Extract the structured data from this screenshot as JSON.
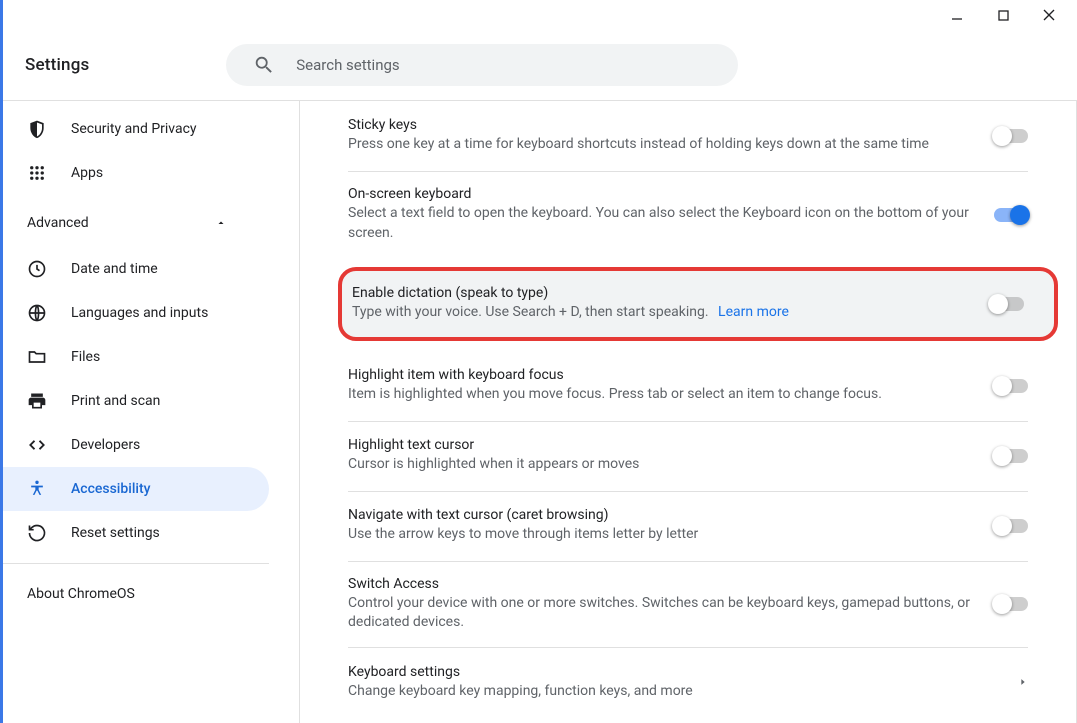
{
  "app": {
    "title": "Settings"
  },
  "search": {
    "placeholder": "Search settings"
  },
  "sidebar": {
    "items": {
      "security": "Security and Privacy",
      "apps": "Apps",
      "advanced": "Advanced",
      "date": "Date and time",
      "lang": "Languages and inputs",
      "files": "Files",
      "print": "Print and scan",
      "dev": "Developers",
      "access": "Accessibility",
      "reset": "Reset settings"
    },
    "about": "About ChromeOS"
  },
  "settings": {
    "sticky": {
      "title": "Sticky keys",
      "desc": "Press one key at a time for keyboard shortcuts instead of holding keys down at the same time",
      "on": false
    },
    "osk": {
      "title": "On-screen keyboard",
      "desc": "Select a text field to open the keyboard. You can also select the Keyboard icon on the bottom of your screen.",
      "on": true
    },
    "dictation": {
      "title": "Enable dictation (speak to type)",
      "desc": "Type with your voice. Use Search + D, then start speaking.",
      "learn": "Learn more",
      "on": false
    },
    "focus": {
      "title": "Highlight item with keyboard focus",
      "desc": "Item is highlighted when you move focus. Press tab or select an item to change focus.",
      "on": false
    },
    "cursor": {
      "title": "Highlight text cursor",
      "desc": "Cursor is highlighted when it appears or moves",
      "on": false
    },
    "caret": {
      "title": "Navigate with text cursor (caret browsing)",
      "desc": "Use the arrow keys to move through items letter by letter",
      "on": false
    },
    "switch": {
      "title": "Switch Access",
      "desc": "Control your device with one or more switches. Switches can be keyboard keys, gamepad buttons, or dedicated devices.",
      "on": false
    },
    "keyboard": {
      "title": "Keyboard settings",
      "desc": "Change keyboard key mapping, function keys, and more"
    }
  }
}
